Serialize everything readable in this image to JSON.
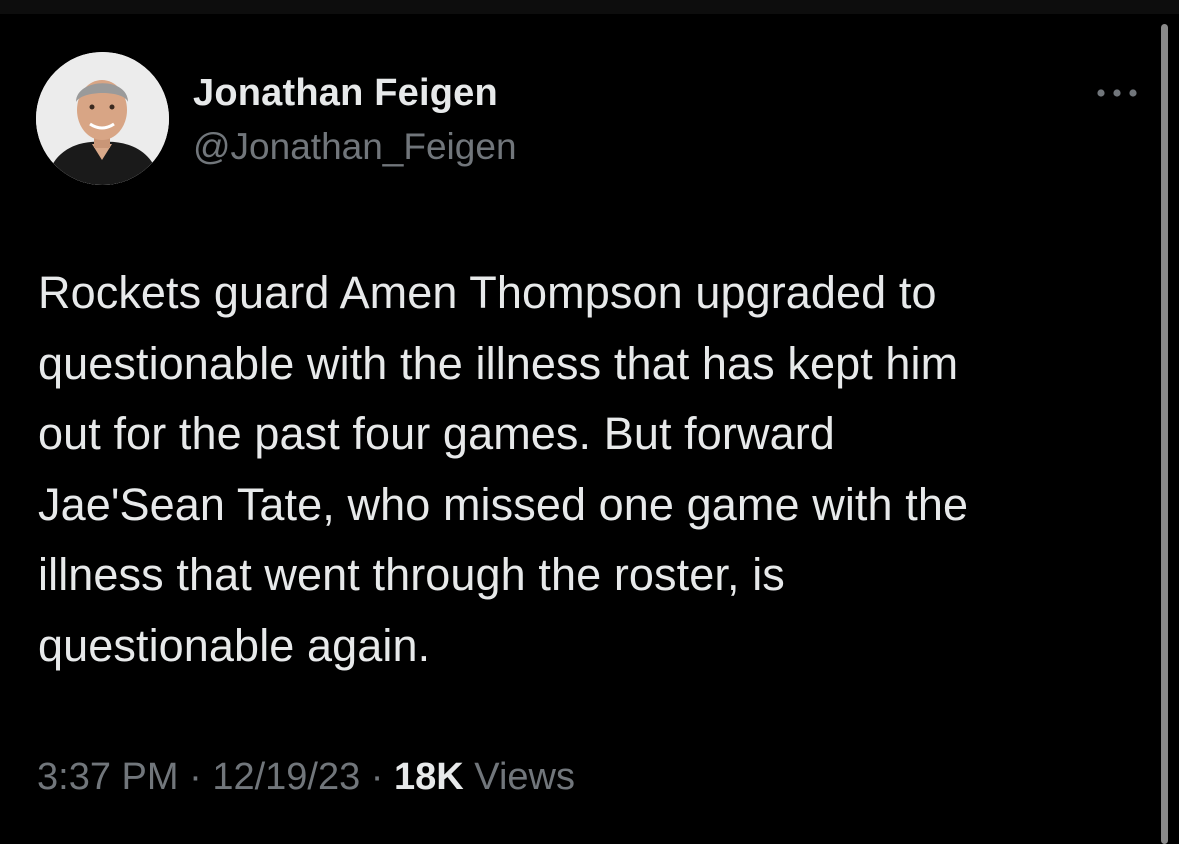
{
  "author": {
    "display_name": "Jonathan Feigen",
    "handle": "@Jonathan_Feigen",
    "avatar_icon": "profile-photo-icon"
  },
  "tweet": {
    "text_lines": [
      "Rockets guard Amen Thompson upgraded to",
      "questionable with the illness that has kept him",
      "out for the past four games. But forward",
      "Jae'Sean Tate, who missed one game with the",
      "illness that went through the roster, is",
      "questionable again."
    ]
  },
  "meta": {
    "time": "3:37 PM",
    "separator": "·",
    "date": "12/19/23",
    "views_count": "18K",
    "views_label": "Views"
  },
  "icons": {
    "more": "more-horizontal-icon"
  },
  "colors": {
    "background": "#000000",
    "primary_text": "#e7e9ea",
    "secondary_text": "#71767b"
  }
}
